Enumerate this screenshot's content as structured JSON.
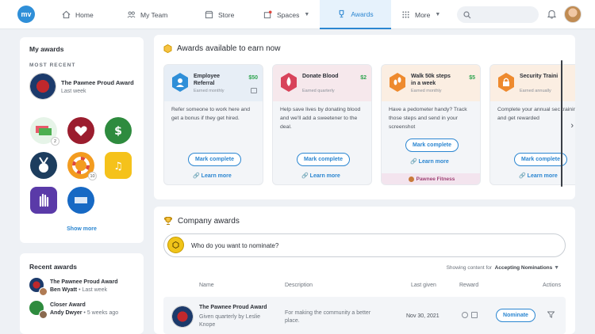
{
  "app": {
    "logo_text": "mv"
  },
  "nav": {
    "home": "Home",
    "team": "My Team",
    "store": "Store",
    "spaces": "Spaces",
    "awards": "Awards",
    "more": "More"
  },
  "my_awards": {
    "title": "My awards",
    "most_recent_label": "MOST RECENT",
    "recent_title": "The Pawnee Proud Award",
    "recent_when": "Last week",
    "badge_counts": [
      "2",
      "10"
    ],
    "show_more": "Show more"
  },
  "recent_awards": {
    "title": "Recent awards",
    "items": [
      {
        "award": "The Pawnee Proud Award",
        "person": "Ben Wyatt",
        "when": "Last week"
      },
      {
        "award": "Closer Award",
        "person": "Andy Dwyer",
        "when": "5 weeks ago"
      }
    ],
    "separator": "•"
  },
  "available": {
    "title": "Awards available to earn now",
    "mark_complete": "Mark complete",
    "learn_more": "Learn more",
    "cards": [
      {
        "name": "Employee Referral",
        "freq": "Earned monthly",
        "amount": "$50",
        "desc": "Refer someone to work here and get a bonus if they get hired."
      },
      {
        "name": "Donate Blood",
        "freq": "Earned quarterly",
        "amount": "$2",
        "desc": "Help save lives by donating blood and we'll add a sweetener to the deal."
      },
      {
        "name": "Walk 50k steps in a week",
        "freq": "Earned monthly",
        "amount": "$5",
        "desc": "Have a pedometer handy? Track those steps and send in your screenshot",
        "sponsor": "Pawnee Fitness"
      },
      {
        "name": "Security Traini",
        "freq": "Earned annually",
        "amount": "",
        "desc": "Complete your annual sec training and get rewarded"
      }
    ]
  },
  "company": {
    "title": "Company awards",
    "nominate_prompt": "Who do you want to nominate?",
    "showing_prefix": "Showing content for",
    "showing_value": "Accepting Nominations",
    "columns": {
      "name": "Name",
      "description": "Description",
      "last_given": "Last given",
      "reward": "Reward",
      "actions": "Actions"
    },
    "row": {
      "name": "The Pawnee Proud Award",
      "given": "Given quarterly by Leslie Knope",
      "description": "For making the community a better place.",
      "last_given": "Nov 30, 2021",
      "action": "Nominate"
    }
  },
  "colors": {
    "accent": "#2b86d1",
    "money": "#2ea44f",
    "sponsor": "#a04477"
  }
}
